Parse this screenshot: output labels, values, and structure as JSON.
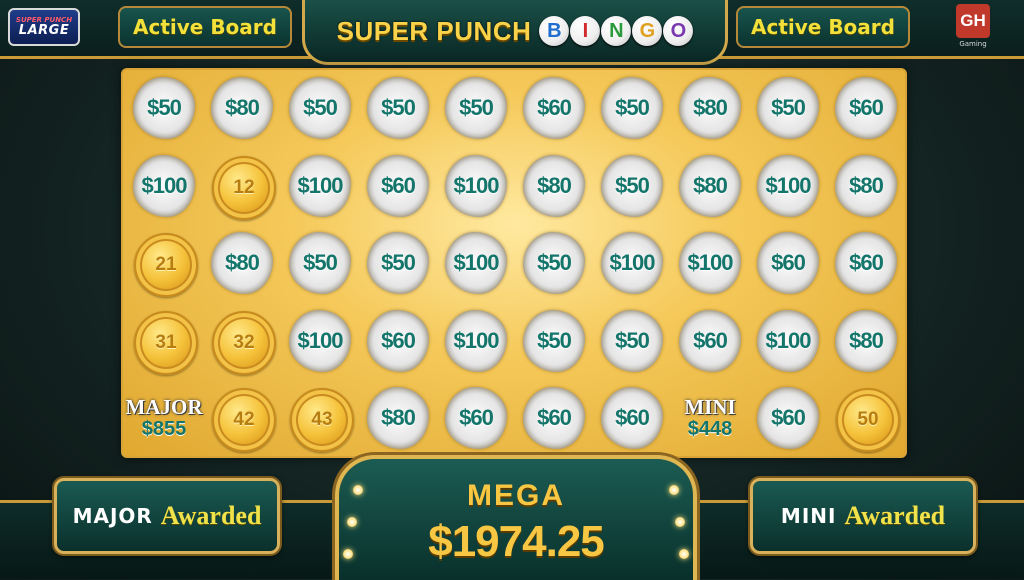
{
  "header": {
    "logo_top": "SUPER PUNCH",
    "logo_main": "LARGE",
    "left_board_label": "Active Board",
    "right_board_label": "Active Board",
    "title": "SUPER PUNCH",
    "bingo_letters": [
      "B",
      "I",
      "N",
      "G",
      "O"
    ],
    "bingo_colors": [
      "#1f6fd1",
      "#d12a2a",
      "#2a9a3a",
      "#e0a020",
      "#7a3ab0"
    ],
    "brand_badge": "GH",
    "brand_text": "Gaming"
  },
  "board": {
    "rows": [
      [
        {
          "type": "prize",
          "value": "$50"
        },
        {
          "type": "prize",
          "value": "$80"
        },
        {
          "type": "prize",
          "value": "$50"
        },
        {
          "type": "prize",
          "value": "$50"
        },
        {
          "type": "prize",
          "value": "$50"
        },
        {
          "type": "prize",
          "value": "$60"
        },
        {
          "type": "prize",
          "value": "$50"
        },
        {
          "type": "prize",
          "value": "$80"
        },
        {
          "type": "prize",
          "value": "$50"
        },
        {
          "type": "prize",
          "value": "$60"
        }
      ],
      [
        {
          "type": "prize",
          "value": "$100"
        },
        {
          "type": "coin",
          "value": "12"
        },
        {
          "type": "prize",
          "value": "$100"
        },
        {
          "type": "prize",
          "value": "$60"
        },
        {
          "type": "prize",
          "value": "$100"
        },
        {
          "type": "prize",
          "value": "$80"
        },
        {
          "type": "prize",
          "value": "$50"
        },
        {
          "type": "prize",
          "value": "$80"
        },
        {
          "type": "prize",
          "value": "$100"
        },
        {
          "type": "prize",
          "value": "$80"
        }
      ],
      [
        {
          "type": "coin",
          "value": "21"
        },
        {
          "type": "prize",
          "value": "$80"
        },
        {
          "type": "prize",
          "value": "$50"
        },
        {
          "type": "prize",
          "value": "$50"
        },
        {
          "type": "prize",
          "value": "$100"
        },
        {
          "type": "prize",
          "value": "$50"
        },
        {
          "type": "prize",
          "value": "$100"
        },
        {
          "type": "prize",
          "value": "$100"
        },
        {
          "type": "prize",
          "value": "$60"
        },
        {
          "type": "prize",
          "value": "$60"
        }
      ],
      [
        {
          "type": "coin",
          "value": "31"
        },
        {
          "type": "coin",
          "value": "32"
        },
        {
          "type": "prize",
          "value": "$100"
        },
        {
          "type": "prize",
          "value": "$60"
        },
        {
          "type": "prize",
          "value": "$100"
        },
        {
          "type": "prize",
          "value": "$50"
        },
        {
          "type": "prize",
          "value": "$50"
        },
        {
          "type": "prize",
          "value": "$60"
        },
        {
          "type": "prize",
          "value": "$100"
        },
        {
          "type": "prize",
          "value": "$80"
        }
      ],
      [
        {
          "type": "jackpot",
          "label": "MAJOR",
          "value": "$855"
        },
        {
          "type": "coin",
          "value": "42"
        },
        {
          "type": "coin",
          "value": "43"
        },
        {
          "type": "prize",
          "value": "$80"
        },
        {
          "type": "prize",
          "value": "$60"
        },
        {
          "type": "prize",
          "value": "$60"
        },
        {
          "type": "prize",
          "value": "$60"
        },
        {
          "type": "jackpot",
          "label": "MINI",
          "value": "$448"
        },
        {
          "type": "prize",
          "value": "$60"
        },
        {
          "type": "coin",
          "value": "50"
        }
      ]
    ]
  },
  "footer": {
    "major_label": "MAJOR",
    "major_status": "Awarded",
    "mega_label": "MEGA",
    "mega_value": "$1974.25",
    "mini_label": "MINI",
    "mini_status": "Awarded"
  }
}
